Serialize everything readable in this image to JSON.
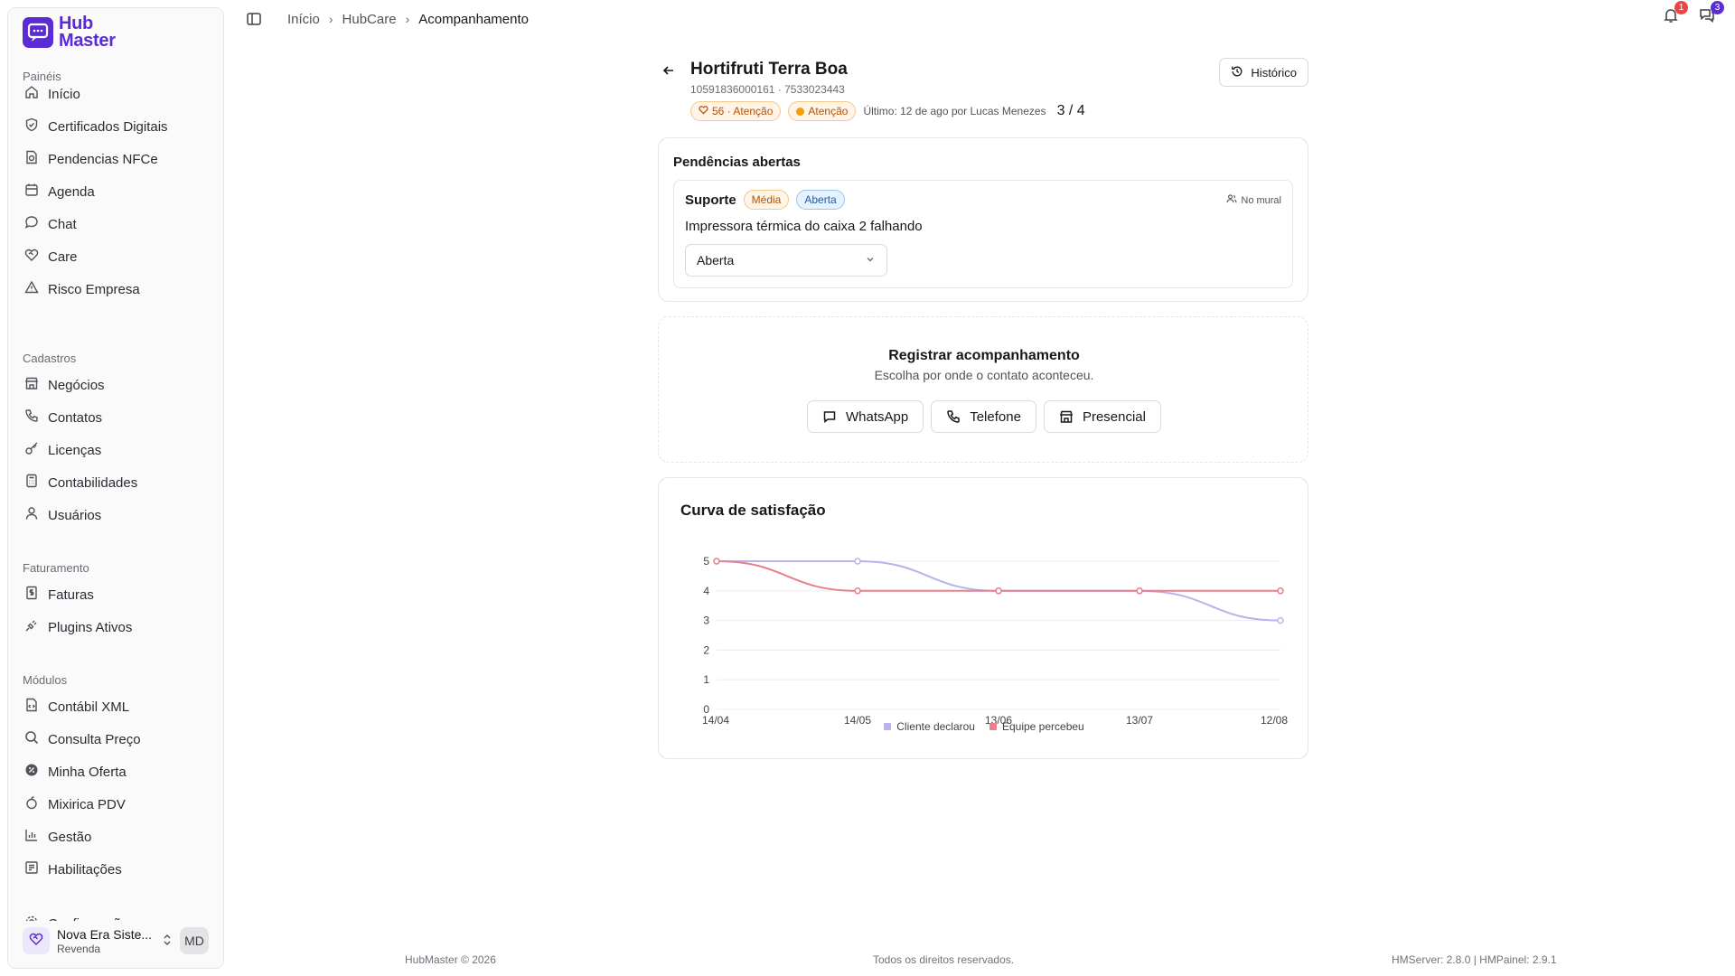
{
  "brand": {
    "line1": "Hub",
    "line2": "Master",
    "color": "#5b2bd6"
  },
  "sidebar": {
    "sections": [
      {
        "title": "Painéis",
        "items": [
          {
            "label": "Início",
            "icon": "home-icon"
          },
          {
            "label": "Certificados Digitais",
            "icon": "shield-icon"
          },
          {
            "label": "Pendencias NFCe",
            "icon": "document-icon"
          },
          {
            "label": "Agenda",
            "icon": "calendar-icon"
          },
          {
            "label": "Chat",
            "icon": "chat-icon"
          },
          {
            "label": "Care",
            "icon": "heart-handshake-icon"
          },
          {
            "label": "Risco Empresa",
            "icon": "alert-triangle-icon"
          }
        ]
      },
      {
        "title": "Cadastros",
        "items": [
          {
            "label": "Negócios",
            "icon": "store-icon"
          },
          {
            "label": "Contatos",
            "icon": "phone-icon"
          },
          {
            "label": "Licenças",
            "icon": "key-icon"
          },
          {
            "label": "Contabilidades",
            "icon": "calculator-icon"
          },
          {
            "label": "Usuários",
            "icon": "users-icon"
          }
        ]
      },
      {
        "title": "Faturamento",
        "items": [
          {
            "label": "Faturas",
            "icon": "receipt-icon"
          },
          {
            "label": "Plugins Ativos",
            "icon": "plug-icon"
          }
        ]
      },
      {
        "title": "Módulos",
        "items": [
          {
            "label": "Contábil XML",
            "icon": "file-code-icon"
          },
          {
            "label": "Consulta Preço",
            "icon": "search-price-icon"
          },
          {
            "label": "Minha Oferta",
            "icon": "badge-percent-icon"
          },
          {
            "label": "Mixirica PDV",
            "icon": "fruit-icon"
          },
          {
            "label": "Gestão",
            "icon": "bar-chart-icon"
          },
          {
            "label": "Habilitações",
            "icon": "list-check-icon"
          },
          {
            "label": "Configurações",
            "icon": "settings-icon"
          }
        ]
      }
    ],
    "user": {
      "name": "Nova Era Siste...",
      "role": "Revenda",
      "initials": "MD"
    }
  },
  "breadcrumb": [
    "Início",
    "HubCare",
    "Acompanhamento"
  ],
  "notifications": {
    "bell_count": "1",
    "messages_count": "3",
    "bell_color": "#ef4444",
    "messages_color": "#5b2bd6"
  },
  "client": {
    "name": "Hortifruti Terra Boa",
    "ids": "10591836000161 · 7533023443",
    "score_pill": "56 · Atenção",
    "status_pill": "Atenção",
    "last": "Último: 12 de ago por Lucas Menezes",
    "ratio": "3 / 4",
    "history_label": "Histórico"
  },
  "pendencias": {
    "title": "Pendências abertas",
    "item": {
      "category": "Suporte",
      "priority": "Média",
      "status": "Aberta",
      "mural": "No mural",
      "description": "Impressora térmica do caixa 2 falhando",
      "select_value": "Aberta"
    }
  },
  "registrar": {
    "title": "Registrar acompanhamento",
    "subtitle": "Escolha por onde o contato aconteceu.",
    "buttons": [
      "WhatsApp",
      "Telefone",
      "Presencial"
    ]
  },
  "chart_card_title": "Curva de satisfação",
  "chart_data": {
    "type": "line",
    "title": "Curva de satisfação",
    "x": [
      "14/04",
      "14/05",
      "13/06",
      "13/07",
      "12/08"
    ],
    "ylim": [
      0,
      5
    ],
    "yticks": [
      "0",
      "1",
      "2",
      "3",
      "4",
      "5"
    ],
    "grid": true,
    "legend_position": "bottom",
    "series": [
      {
        "name": "Cliente declarou",
        "color": "#b8b3ec",
        "values": [
          5,
          5,
          4,
          4,
          3
        ]
      },
      {
        "name": "Equipe percebeu",
        "color": "#e8808b",
        "values": [
          5,
          4,
          4,
          4,
          4
        ]
      }
    ]
  },
  "footer": {
    "left": "HubMaster © 2026",
    "center": "Todos os direitos reservados.",
    "right": "HMServer: 2.8.0 | HMPainel: 2.9.1"
  }
}
